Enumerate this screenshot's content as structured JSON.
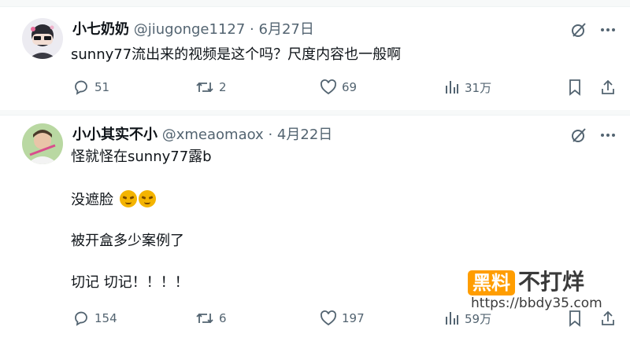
{
  "posts": [
    {
      "name": "小七奶奶",
      "handle": "@jiugonge1127",
      "dot": "·",
      "date": "6月27日",
      "lines": [
        "sunny77流出来的视频是这个吗？尺度内容也一般啊"
      ],
      "replies": "51",
      "reposts": "2",
      "likes": "69",
      "views": "31万"
    },
    {
      "name": "小小其实不小",
      "handle": "@xmeaomaox",
      "dot": "·",
      "date": "4月22日",
      "line1": "怪就怪在sunny77露b",
      "line2": "没遮脸",
      "line3": "被开盒多少案例了",
      "line4": "切记 切记！！！！",
      "replies": "154",
      "reposts": "6",
      "likes": "197",
      "views": "59万"
    }
  ],
  "watermark": {
    "badge": "黑料",
    "text": "不打烊",
    "url": "https://bbdy35.com"
  },
  "icons": [
    "grok-icon",
    "more-icon",
    "reply-icon",
    "repost-icon",
    "like-icon",
    "views-icon",
    "bookmark-icon",
    "share-icon"
  ],
  "colors": {
    "muted": "#536471",
    "text": "#0f1419",
    "watermark": "#ff9d00"
  }
}
